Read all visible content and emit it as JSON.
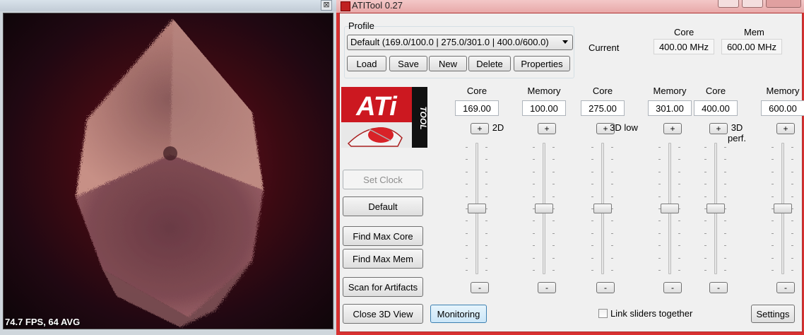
{
  "view_window": {
    "fps": "74.7 FPS, 64 AVG",
    "close_glyph": "⊠"
  },
  "ati": {
    "title": "ATITool 0.27",
    "profile": {
      "label": "Profile",
      "selected": "Default (169.0/100.0 | 275.0/301.0 | 400.0/600.0)",
      "buttons": {
        "load": "Load",
        "save": "Save",
        "new": "New",
        "delete": "Delete",
        "properties": "Properties"
      }
    },
    "current": {
      "label": "Current",
      "core_header": "Core",
      "mem_header": "Mem",
      "core_value": "400.00 MHz",
      "mem_value": "600.00 MHz"
    },
    "logo_text": "ATi",
    "logo_side": "TOOL",
    "clock_groups": [
      {
        "mode": "2D",
        "core_header": "Core",
        "mem_header": "Memory",
        "core_value": "169.00",
        "mem_value": "100.00",
        "core_level": 0.5,
        "mem_level": 0.5
      },
      {
        "mode": "3D low",
        "core_header": "Core",
        "mem_header": "Memory",
        "core_value": "275.00",
        "mem_value": "301.00",
        "core_level": 0.5,
        "mem_level": 0.5
      },
      {
        "mode": "3D perf.",
        "core_header": "Core",
        "mem_header": "Memory",
        "core_value": "400.00",
        "mem_value": "600.00",
        "core_level": 0.5,
        "mem_level": 0.5
      }
    ],
    "plus": "+",
    "minus": "-",
    "buttons": {
      "set_clock": "Set Clock",
      "default": "Default",
      "find_max_core": "Find Max Core",
      "find_max_mem": "Find Max Mem",
      "scan_artifacts": "Scan for Artifacts",
      "close_3d": "Close 3D View",
      "monitoring": "Monitoring",
      "settings": "Settings"
    },
    "link_sliders": "Link sliders together",
    "colors": {
      "frame": "#d83030",
      "logo_red": "#cc1820",
      "monitor_active": "#cbe6f8"
    }
  }
}
